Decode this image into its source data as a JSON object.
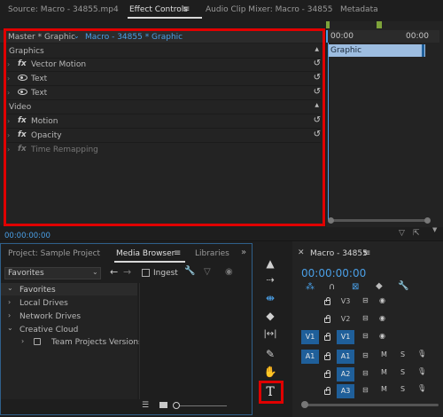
{
  "source_panel": {
    "tabs": [
      "Source: Macro - 34855.mp4",
      "Effect Controls",
      "Audio Clip Mixer: Macro - 34855",
      "Metadata"
    ],
    "menu_glyph": "≡"
  },
  "effect_controls": {
    "master_label": "Master * Graphic",
    "clip_label": "Macro - 34855 * Graphic",
    "sections": [
      {
        "label": "Graphics"
      },
      {
        "label": "Vector Motion"
      },
      {
        "label": "Text"
      },
      {
        "label": "Text"
      },
      {
        "label": "Video"
      },
      {
        "label": "Motion"
      },
      {
        "label": "Opacity"
      },
      {
        "label": "Time Remapping"
      }
    ],
    "timecode": "00:00:00:00",
    "mini_timeline": {
      "start": "00:00",
      "end": "00:00",
      "clip": "Graphic"
    }
  },
  "project_panel": {
    "tabs": [
      "Project: Sample Project",
      "Media Browser",
      "Libraries"
    ],
    "dropdown": "Favorites",
    "ingest": "Ingest",
    "tree": [
      "Favorites",
      "Local Drives",
      "Network Drives",
      "Creative Cloud",
      "Team Projects Versions"
    ]
  },
  "tools": [
    "selection",
    "track-select",
    "ripple-edit",
    "razor",
    "slip",
    "pen",
    "hand",
    "type"
  ],
  "timeline": {
    "title": "Macro - 34855",
    "timecode": "00:00:00:00",
    "tracks": [
      {
        "src": "",
        "name": "V3",
        "m": "",
        "s": ""
      },
      {
        "src": "",
        "name": "V2",
        "m": "",
        "s": ""
      },
      {
        "src": "V1",
        "name": "V1",
        "m": "",
        "s": ""
      },
      {
        "src": "A1",
        "name": "A1",
        "m": "M",
        "s": "S"
      },
      {
        "src": "",
        "name": "A2",
        "m": "M",
        "s": "S"
      },
      {
        "src": "",
        "name": "A3",
        "m": "M",
        "s": "S"
      }
    ]
  },
  "colors": {
    "accent_blue": "#4a9fe6",
    "highlight_red": "#e00000",
    "track_blue": "#1f5f9a"
  }
}
